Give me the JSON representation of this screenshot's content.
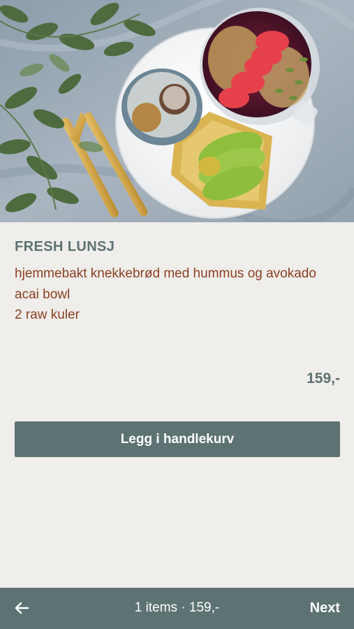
{
  "product": {
    "title": "FRESH LUNSJ",
    "description_lines": [
      "hjemmebakt knekkebrød med hummus og avokado",
      "acai bowl",
      "2 raw kuler"
    ],
    "price": "159,-",
    "add_to_cart_label": "Legg i handlekurv"
  },
  "bottom_bar": {
    "back_icon": "arrow-left-icon",
    "cart_summary": "1 items · 159,-",
    "next_label": "Next"
  },
  "colors": {
    "accent": "#5d7272",
    "description_text": "#8c3f24",
    "background": "#efeeea"
  }
}
